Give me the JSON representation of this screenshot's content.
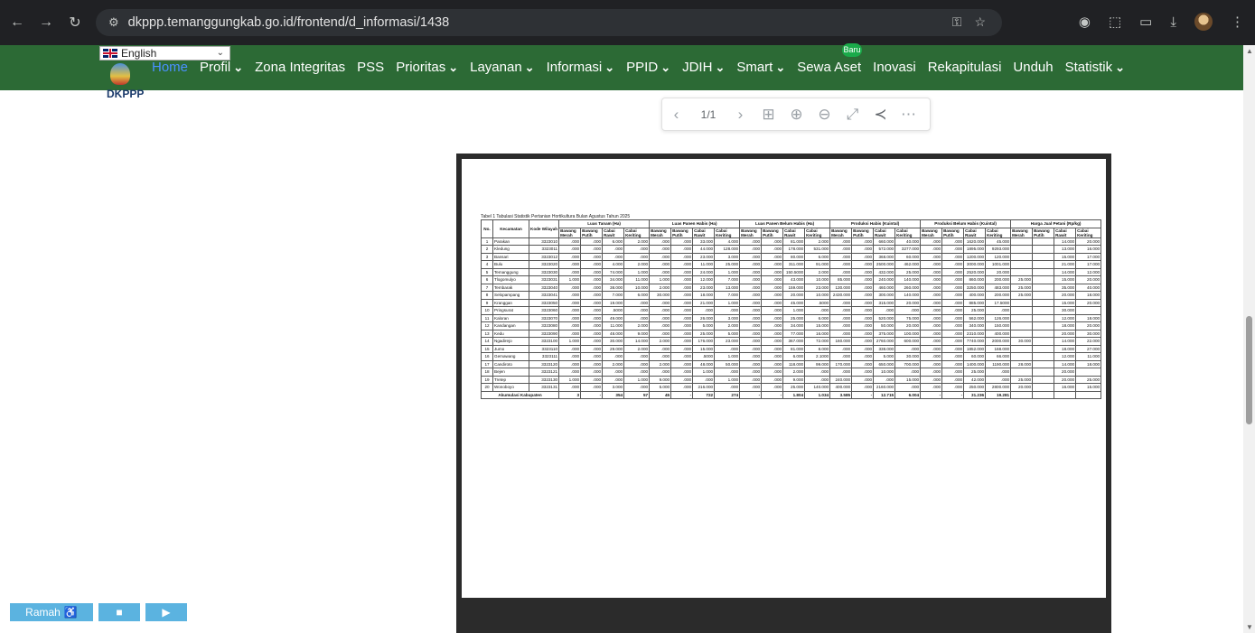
{
  "browser": {
    "url": "dkppp.temanggungkab.go.id/frontend/d_informasi/1438"
  },
  "site": {
    "language": "English",
    "logo_text": "DKPPP",
    "menu": [
      {
        "label": "Home",
        "active": true,
        "dropdown": false
      },
      {
        "label": "Profil",
        "dropdown": true
      },
      {
        "label": "Zona Integritas",
        "dropdown": false
      },
      {
        "label": "PSS",
        "dropdown": false
      },
      {
        "label": "Prioritas",
        "dropdown": true
      },
      {
        "label": "Layanan",
        "dropdown": true
      },
      {
        "label": "Informasi",
        "dropdown": true
      },
      {
        "label": "PPID",
        "dropdown": true
      },
      {
        "label": "JDIH",
        "dropdown": true
      },
      {
        "label": "Smart",
        "dropdown": true
      },
      {
        "label": "Sewa Aset",
        "dropdown": false
      },
      {
        "label": "Inovasi",
        "dropdown": false
      },
      {
        "label": "Rekapitulasi",
        "dropdown": false
      },
      {
        "label": "Unduh",
        "dropdown": false
      },
      {
        "label": "Statistik",
        "dropdown": true
      }
    ],
    "badge": "Baru"
  },
  "pdf": {
    "page_indicator": "1/1",
    "title": "Tabel 1 Tabulasi Statistik Pertanian Hortikultura Bulan Agustus Tahun 2025",
    "col_no": "No.",
    "col_kec": "Kecamatan",
    "col_kode": "Kode Wilayah",
    "groups": [
      "Luas Tanam (Ha)",
      "Luas Panen Habis (Ha)",
      "Luas Panen Belum Habis (Ha)",
      "Produksi Habis (Kuintal)",
      "Produksi Belum Habis (Kuintal)",
      "Harga Jual Petani (Rp/kg)"
    ],
    "subcols": [
      "Bawang Merah",
      "Bawang Putih",
      "Cabai Rawit",
      "Cabai Keriting"
    ],
    "rows": [
      [
        "1",
        "Parakan",
        "3323010",
        ".000",
        ".000",
        "6.000",
        "2.000",
        ".000",
        ".000",
        "33.000",
        "4.000",
        ".000",
        ".000",
        "81.000",
        "2.000",
        ".000",
        ".000",
        "660.000",
        "40.000",
        ".000",
        ".000",
        "1620.000",
        "45.000",
        "",
        "",
        "14.000",
        "20.000"
      ],
      [
        "2",
        "Kledung",
        "3323011",
        ".000",
        ".000",
        ".000",
        ".000",
        ".000",
        ".000",
        "44.000",
        "128.000",
        ".000",
        ".000",
        "178.000",
        "531.000",
        ".000",
        ".000",
        "572.000",
        "3277.000",
        ".000",
        ".000",
        "1895.000",
        "9293.000",
        "",
        "",
        "13.000",
        "16.000"
      ],
      [
        "3",
        "Bansari",
        "3323012",
        ".000",
        ".000",
        ".000",
        ".000",
        ".000",
        ".000",
        "23.000",
        "3.000",
        ".000",
        ".000",
        "80.000",
        "6.000",
        ".000",
        ".000",
        "368.000",
        "60.000",
        ".000",
        ".000",
        "1200.000",
        "120.000",
        "",
        "",
        "15.000",
        "17.000"
      ],
      [
        "4",
        "Bulu",
        "3323020",
        ".000",
        ".000",
        "4.000",
        "2.000",
        ".000",
        ".000",
        "11.000",
        "25.000",
        ".000",
        ".000",
        "311.000",
        "91.000",
        ".000",
        ".000",
        "2500.000",
        "462.000",
        ".000",
        ".000",
        "3000.000",
        "1001.000",
        "",
        "",
        "21.000",
        "17.000"
      ],
      [
        "5",
        "Temanggung",
        "3323030",
        ".000",
        ".000",
        "74.000",
        "1.000",
        ".000",
        ".000",
        "24.000",
        "1.000",
        ".000",
        ".000",
        "150.5000",
        "2.000",
        ".000",
        ".000",
        "432.000",
        "25.000",
        ".000",
        ".000",
        "2520.000",
        "20.000",
        "",
        "",
        "14.000",
        "12.000"
      ],
      [
        "6",
        "Tlogomulyo",
        "3323031",
        "1.000",
        ".000",
        "34.000",
        "11.000",
        "1.000",
        ".000",
        "12.000",
        "7.000",
        ".000",
        ".000",
        "43.000",
        "10.000",
        "85.000",
        ".000",
        "240.000",
        "140.000",
        ".000",
        ".000",
        "860.000",
        "200.000",
        "25.000",
        "",
        "15.000",
        "20.000"
      ],
      [
        "7",
        "Tembarak",
        "3323040",
        ".000",
        ".000",
        "38.000",
        "10.000",
        "2.000",
        ".000",
        "23.000",
        "13.000",
        ".000",
        ".000",
        "159.000",
        "23.000",
        "130.000",
        ".000",
        "460.000",
        "260.000",
        ".000",
        ".000",
        "3250.000",
        "483.000",
        "25.000",
        "",
        "35.000",
        "40.000"
      ],
      [
        "8",
        "Selopampang",
        "3323041",
        ".000",
        ".000",
        "7.000",
        "6.000",
        "30.000",
        ".000",
        "18.000",
        "7.000",
        ".000",
        ".000",
        "20.000",
        "10.000",
        "2430.000",
        ".000",
        "300.000",
        "140.000",
        ".000",
        ".000",
        "400.000",
        "200.000",
        "25.000",
        "",
        "20.000",
        "18.000"
      ],
      [
        "9",
        "Kranggan",
        "3323050",
        ".000",
        ".000",
        "19.000",
        ".000",
        ".000",
        ".000",
        "21.000",
        "1.000",
        ".000",
        ".000",
        "45.000",
        ".5000",
        ".000",
        ".000",
        "315.000",
        "20.000",
        ".000",
        ".000",
        "885.000",
        "17.5000",
        "",
        "",
        "15.000",
        "20.000"
      ],
      [
        "10",
        "Pringsurat",
        "3323060",
        ".000",
        ".000",
        ".5000",
        ".000",
        ".000",
        ".000",
        ".000",
        ".000",
        ".000",
        ".000",
        "1.000",
        ".000",
        ".000",
        ".000",
        ".000",
        ".000",
        ".000",
        ".000",
        "25.000",
        ".000",
        "",
        "",
        "30.000",
        ""
      ],
      [
        "11",
        "Kaloran",
        "3323070",
        ".000",
        ".000",
        "49.000",
        ".000",
        ".000",
        ".000",
        "26.000",
        "3.000",
        ".000",
        ".000",
        "25.000",
        "6.000",
        ".000",
        ".000",
        "520.000",
        "75.000",
        ".000",
        ".000",
        "562.000",
        "126.000",
        "",
        "",
        "12.000",
        "18.000"
      ],
      [
        "12",
        "Kandangan",
        "3323080",
        ".000",
        ".000",
        "11.000",
        "2.000",
        ".000",
        ".000",
        "5.000",
        "2.000",
        ".000",
        ".000",
        "34.000",
        "15.000",
        ".000",
        ".000",
        "50.000",
        "20.000",
        ".000",
        ".000",
        "340.000",
        "150.000",
        "",
        "",
        "18.000",
        "20.000"
      ],
      [
        "13",
        "Kedu",
        "3323090",
        ".000",
        ".000",
        "48.000",
        "9.000",
        ".000",
        ".000",
        "25.000",
        "5.000",
        ".000",
        ".000",
        "77.000",
        "16.000",
        ".000",
        ".000",
        "375.000",
        "100.000",
        ".000",
        ".000",
        "2310.000",
        "400.000",
        "",
        "",
        "20.000",
        "30.000"
      ],
      [
        "14",
        "Ngadirejo",
        "3323100",
        "1.000",
        ".000",
        "30.000",
        "14.000",
        "2.000",
        ".000",
        "176.000",
        "23.000",
        ".000",
        ".000",
        "367.000",
        "72.000",
        "160.000",
        ".000",
        "2760.000",
        "600.000",
        ".000",
        ".000",
        "7740.000",
        "2000.000",
        "30.000",
        "",
        "14.000",
        "22.000"
      ],
      [
        "15",
        "Jumo",
        "3323110",
        ".000",
        ".000",
        "29.000",
        "2.000",
        ".000",
        ".000",
        "15.000",
        ".000",
        ".000",
        ".000",
        "81.000",
        "8.000",
        ".000",
        ".000",
        "338.000",
        ".000",
        ".000",
        ".000",
        "1852.000",
        "168.000",
        "",
        "",
        "18.000",
        "27.000"
      ],
      [
        "16",
        "Gemawang",
        "3323111",
        ".000",
        ".000",
        ".000",
        ".000",
        ".000",
        ".000",
        ".5000",
        "1.000",
        ".000",
        ".000",
        "6.000",
        "2.1000",
        ".000",
        ".000",
        "5.000",
        "30.000",
        ".000",
        ".000",
        "60.000",
        "66.000",
        "",
        "",
        "12.000",
        "11.000"
      ],
      [
        "17",
        "Candiroto",
        "3323120",
        ".000",
        ".000",
        "2.000",
        ".000",
        "2.000",
        ".000",
        "48.000",
        "50.000",
        ".000",
        ".000",
        "118.000",
        "99.000",
        "170.000",
        ".000",
        "650.000",
        "700.000",
        ".000",
        ".000",
        "1400.000",
        "1190.000",
        "28.000",
        "",
        "14.000",
        "18.000"
      ],
      [
        "18",
        "Bejen",
        "3323121",
        ".000",
        ".000",
        ".000",
        ".000",
        ".000",
        ".000",
        "1.000",
        ".000",
        ".000",
        ".000",
        "2.000",
        ".000",
        ".000",
        ".000",
        "10.000",
        ".000",
        ".000",
        ".000",
        "25.000",
        ".000",
        "",
        "",
        "20.000",
        ""
      ],
      [
        "19",
        "Tretep",
        "3323130",
        "1.000",
        ".000",
        ".000",
        "1.000",
        "9.000",
        ".000",
        ".000",
        "1.000",
        ".000",
        ".000",
        "9.000",
        ".000",
        "240.000",
        ".000",
        ".000",
        "15.000",
        ".000",
        ".000",
        "42.000",
        ".000",
        "25.000",
        "",
        "20.000",
        "25.000"
      ],
      [
        "20",
        "Wonoboyo",
        "3323131",
        ".000",
        ".000",
        "3.000",
        ".000",
        "5.000",
        ".000",
        "216.000",
        ".000",
        ".000",
        ".000",
        "25.000",
        "140.000",
        "400.000",
        ".000",
        "2160.000",
        ".000",
        ".000",
        ".000",
        "250.000",
        "2800.000",
        "20.000",
        "",
        "16.000",
        "15.000"
      ]
    ],
    "total_label": "Akumulasi Kabupaten",
    "totals": [
      "3",
      "-",
      "354",
      "57",
      "45",
      "-",
      "722",
      "274",
      "-",
      "-",
      "1.804",
      "1.034",
      "3.585",
      "-",
      "12.715",
      "6.004",
      "-",
      "-",
      "31.236",
      "19.281",
      "",
      "",
      "",
      ""
    ]
  },
  "a11y": {
    "ramah_label": "Ramah",
    "ramah_icon": "wheelchair-icon"
  }
}
